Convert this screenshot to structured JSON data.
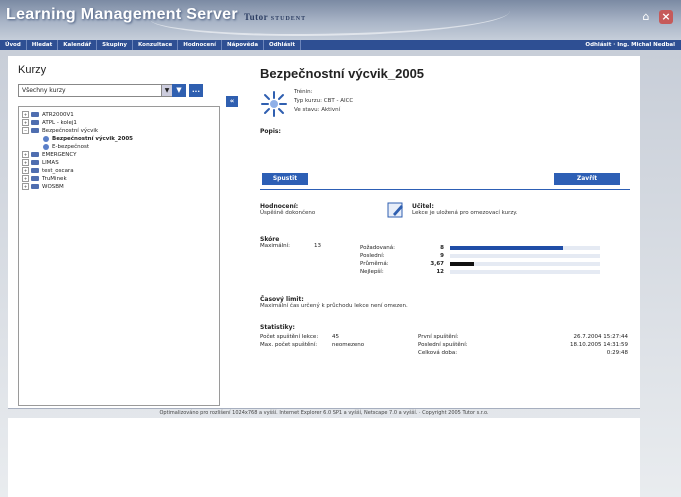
{
  "app": {
    "title": "Learning Management Server",
    "subtitle_main": "Tutor",
    "subtitle_role": "STUDENT"
  },
  "nav": {
    "items": [
      "Úvod",
      "Hledat",
      "Kalendář",
      "Skupiny",
      "Konzultace",
      "Hodnocení",
      "Nápověda",
      "Odhlásit"
    ],
    "right": "Odhlásit · Ing. Michal Nedbal"
  },
  "left": {
    "title": "Kurzy",
    "select_value": "Všechny kurzy",
    "filter_btn": "▼",
    "more_btn": "...",
    "tree": [
      {
        "label": "ATR2000V1",
        "level": 0,
        "expander": "+",
        "type": "folder",
        "bold": false
      },
      {
        "label": "ATPL - kolej1",
        "level": 0,
        "expander": "+",
        "type": "folder",
        "bold": false
      },
      {
        "label": "Bezpečnostní výcvik",
        "level": 0,
        "expander": "−",
        "type": "folder",
        "bold": false
      },
      {
        "label": "Bezpečnostní výcvik_2005",
        "level": 1,
        "expander": "",
        "type": "course",
        "bold": true
      },
      {
        "label": "E-bezpečnost",
        "level": 1,
        "expander": "",
        "type": "course",
        "bold": false
      },
      {
        "label": "EMERGENCY",
        "level": 0,
        "expander": "+",
        "type": "folder",
        "bold": false
      },
      {
        "label": "LIMAS",
        "level": 0,
        "expander": "+",
        "type": "folder",
        "bold": false
      },
      {
        "label": "test_oscara",
        "level": 0,
        "expander": "+",
        "type": "folder",
        "bold": false
      },
      {
        "label": "TruMinek",
        "level": 0,
        "expander": "+",
        "type": "folder",
        "bold": false
      },
      {
        "label": "WOSBM",
        "level": 0,
        "expander": "+",
        "type": "folder",
        "bold": false
      }
    ],
    "collapse_btn": "«"
  },
  "detail": {
    "title": "Bezpečnostní výcvik_2005",
    "meta": [
      "Trénin:",
      "Typ kurzu: CBT - AICC",
      "Ve stavu: Aktivní"
    ],
    "popis_label": "Popis:",
    "btn_left": "Spustit",
    "btn_right": "Zavřít",
    "status_label": "Hodnocení:",
    "status_text": "Úspěšně dokončeno",
    "comment_label": "Učitel:",
    "comment_text": "Lekce je uložená pro omezovací kurzy.",
    "score_label": "Skóre",
    "score_max_label": "Maximální:",
    "score_max_value": "13",
    "score_rows": [
      {
        "label": "Požadovaná:",
        "value": "8",
        "fraction": 0.75,
        "color": "#1f4da7"
      },
      {
        "label": "Poslední:",
        "value": "9",
        "fraction": 0.0,
        "color": "#1f4da7"
      },
      {
        "label": "Průměrná:",
        "value": "3,67",
        "fraction": 0.16,
        "color": "#111111"
      },
      {
        "label": "Nejlepší:",
        "value": "12",
        "fraction": 0.0,
        "color": "#1f4da7"
      }
    ],
    "time_label": "Časový limit:",
    "time_text": "Maximální čas určený k průchodu lekce není omezen.",
    "stats_label": "Statistiky:",
    "stats_left": [
      {
        "label": "Počet spuštění lekce:",
        "value": "45"
      },
      {
        "label": "Max. počet spuštění:",
        "value": "neomezeno"
      }
    ],
    "stats_right": [
      {
        "label": "První spuštění:",
        "value": "26.7.2004  15:27:44"
      },
      {
        "label": "Poslední spuštění:",
        "value": "18.10.2005  14:31:59"
      },
      {
        "label": "Celková doba:",
        "value": "0:29:48"
      }
    ]
  },
  "footer": {
    "text": "Optimalizováno pro rozlišení 1024x768 a vyšší. Internet Explorer 6.0 SP1 a vyšší, Netscape 7.0 a vyšší. · Copyright 2005 Tutor s.r.o."
  }
}
